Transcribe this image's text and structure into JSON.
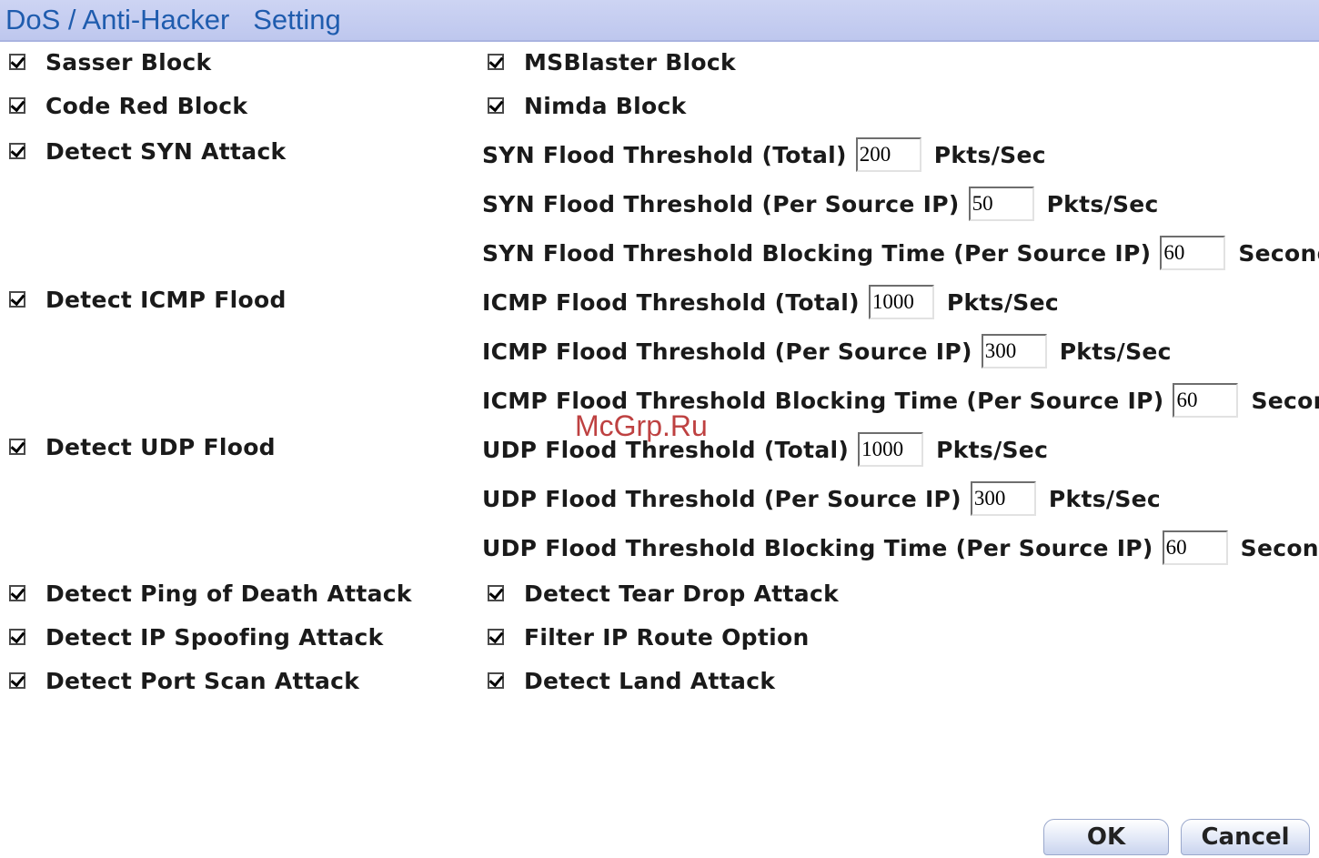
{
  "header": {
    "title": "DoS / Anti-Hacker   Setting"
  },
  "left_options": [
    {
      "label": "Sasser Block",
      "checked": true
    },
    {
      "label": "Code Red Block",
      "checked": true
    },
    {
      "label": "Detect SYN Attack",
      "checked": true
    },
    {
      "label": "Detect ICMP Flood",
      "checked": true
    },
    {
      "label": "Detect UDP Flood",
      "checked": true
    },
    {
      "label": "Detect Ping of Death Attack",
      "checked": true
    },
    {
      "label": "Detect IP Spoofing Attack",
      "checked": true
    },
    {
      "label": "Detect Port Scan Attack",
      "checked": true
    }
  ],
  "right_options": [
    {
      "label": "MSBlaster Block",
      "checked": true
    },
    {
      "label": "Nimda Block",
      "checked": true
    },
    {
      "label": "Detect Tear Drop Attack",
      "checked": true
    },
    {
      "label": "Filter IP Route Option",
      "checked": true
    },
    {
      "label": "Detect Land Attack",
      "checked": true
    }
  ],
  "thresholds": [
    {
      "label": "SYN Flood Threshold (Total)",
      "value": "200",
      "unit": "Pkts/Sec"
    },
    {
      "label": "SYN Flood Threshold (Per Source IP)",
      "value": "50",
      "unit": "Pkts/Sec"
    },
    {
      "label": "SYN Flood Threshold Blocking Time (Per Source IP)",
      "value": "60",
      "unit": "Seconds"
    },
    {
      "label": "ICMP Flood Threshold (Total)",
      "value": "1000",
      "unit": "Pkts/Sec"
    },
    {
      "label": "ICMP Flood Threshold (Per Source IP)",
      "value": "300",
      "unit": "Pkts/Sec"
    },
    {
      "label": "ICMP Flood Threshold Blocking Time (Per Source IP)",
      "value": "60",
      "unit": "Seconds"
    },
    {
      "label": "UDP Flood Threshold (Total)",
      "value": "1000",
      "unit": "Pkts/Sec"
    },
    {
      "label": "UDP Flood Threshold (Per Source IP)",
      "value": "300",
      "unit": "Pkts/Sec"
    },
    {
      "label": "UDP Flood Threshold Blocking Time (Per Source IP)",
      "value": "60",
      "unit": "Seconds"
    }
  ],
  "watermark": "McGrp.Ru",
  "buttons": {
    "ok_label": "OK",
    "cancel_label": "Cancel"
  },
  "colors": {
    "header_bg": "#c5cdf1",
    "title_text": "#1f5cae"
  }
}
